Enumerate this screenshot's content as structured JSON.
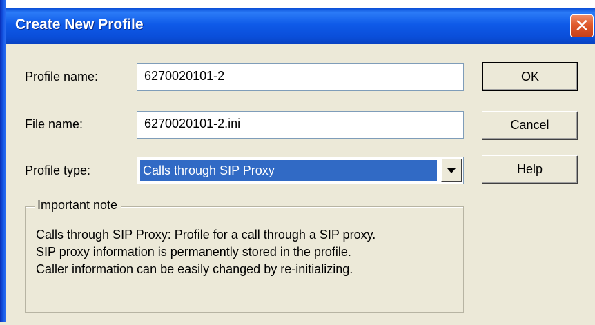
{
  "window": {
    "title": "Create New Profile",
    "close_glyph": "✕"
  },
  "form": {
    "profile_name_label": "Profile name:",
    "profile_name_value": "6270020101-2",
    "file_name_label": "File name:",
    "file_name_value": "6270020101-2.ini",
    "profile_type_label": "Profile type:",
    "profile_type_value": "Calls through SIP Proxy"
  },
  "buttons": {
    "ok": "OK",
    "cancel": "Cancel",
    "help": "Help"
  },
  "note": {
    "title": "Important note",
    "lines": [
      "Calls through SIP Proxy: Profile for a call through a SIP proxy.",
      "SIP proxy information is permanently stored in the profile.",
      "Caller information can be easily changed by re-initializing."
    ]
  },
  "colors": {
    "titlebar": "#0a4ed9",
    "close_button": "#df5a2c",
    "dialog_background": "#ece9d8",
    "selection": "#316ac5"
  }
}
